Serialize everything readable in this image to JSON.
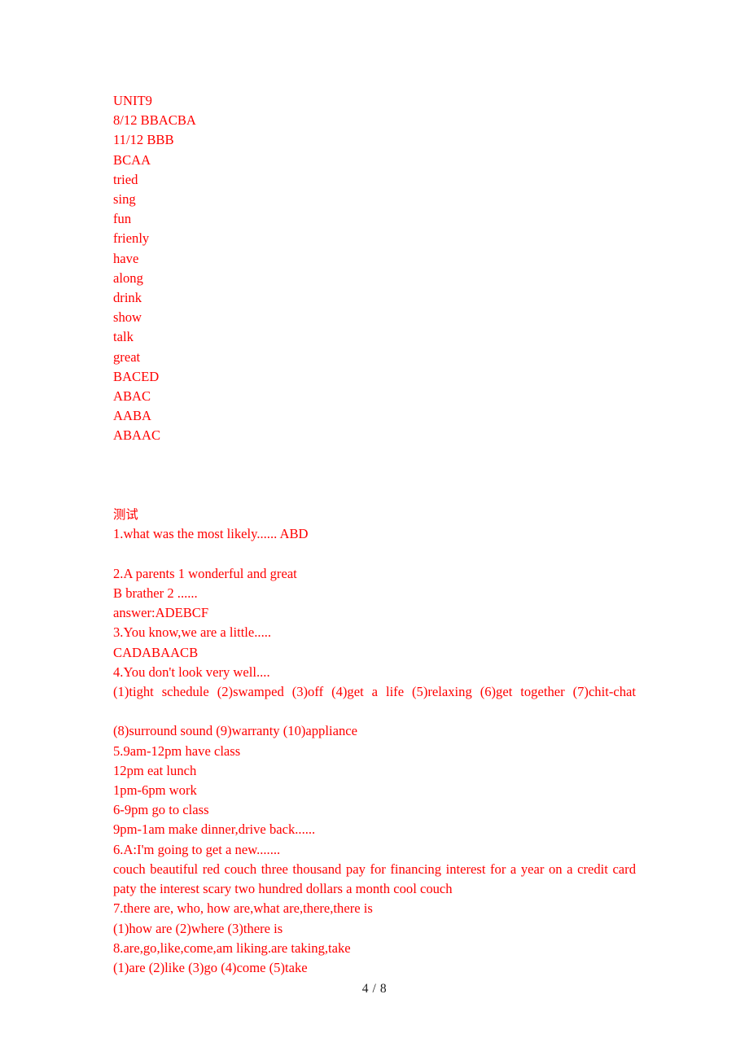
{
  "document": {
    "page_footer": "4 / 8",
    "text_color": "#ff0000",
    "footer_color": "#1a1a1a"
  },
  "unit_section": {
    "heading": "UNIT9",
    "lines": [
      "8/12 BBACBA",
      "11/12 BBB",
      "BCAA",
      "tried",
      "sing",
      "fun",
      "frienly",
      "have",
      "along",
      "drink",
      "show",
      "talk",
      "great",
      "BACED",
      "ABAC",
      "AABA",
      "ABAAC"
    ]
  },
  "test_section": {
    "heading": "测试",
    "q1": "1.what was the most likely...... ABD",
    "q2_line1": "2.A parents 1 wonderful and great",
    "q2_line2": "B brather 2 ......",
    "q2_answer": "answer:ADEBCF",
    "q3": "3.You know,we are a little.....",
    "q3_answer": "CADABAACB",
    "q4": "4.You don't look very well....",
    "q4_answers_line1": "(1)tight schedule (2)swamped (3)off (4)get a life (5)relaxing (6)get together (7)chit-chat",
    "q4_answers_line2": "(8)surround sound (9)warranty (10)appliance",
    "q5_lines": [
      "5.9am-12pm have class",
      "12pm eat lunch",
      "1pm-6pm work",
      "6-9pm go to class",
      "9pm-1am make dinner,drive back......"
    ],
    "q6": "6.A:I'm going to get a new.......",
    "q6_answers": "couch beautiful red couch three thousand pay for financing interest for a year on a credit card paty the interest scary two hundred dollars a month cool couch",
    "q7": "7.there are, who, how are,what are,there,there is",
    "q7_answers": "(1)how are (2)where (3)there is",
    "q8": "8.are,go,like,come,am liking.are taking,take",
    "q8_answers": "(1)are (2)like (3)go (4)come (5)take"
  }
}
